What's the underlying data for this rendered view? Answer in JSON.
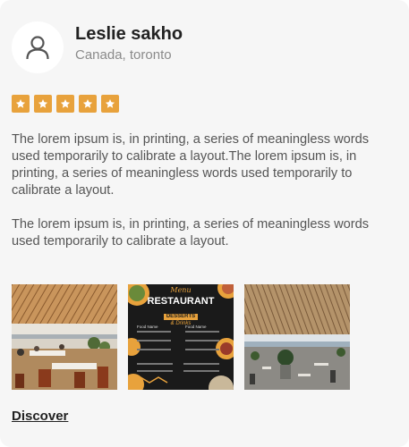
{
  "reviewer": {
    "name": "Leslie sakho",
    "location": "Canada, toronto",
    "avatar_icon": "user-icon"
  },
  "rating": {
    "value": 5,
    "max": 5,
    "star_color": "#e8a23c"
  },
  "review": {
    "paragraph_1": "The lorem ipsum is, in printing, a series of meaningless words used temporarily to calibrate a layout.The lorem ipsum is, in printing, a series of meaningless words used temporarily to calibrate a layout.",
    "paragraph_2": "The lorem ipsum is, in printing, a series of meaningless words used temporarily to calibrate a layout."
  },
  "menu_photo": {
    "brand": "Menu",
    "title": "RESTAURANT",
    "section_left": "DESSERTS",
    "section_left_sub": "& Drinks",
    "item_label": "Food Name"
  },
  "link": {
    "label": "Discover"
  }
}
